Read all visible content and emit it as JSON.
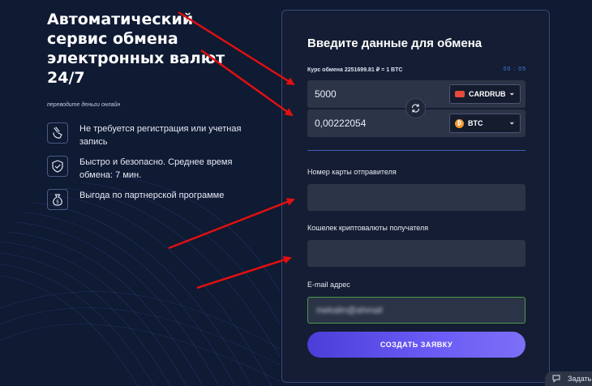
{
  "hero": {
    "title": "Автоматический сервис обмена электронных валют 24/7",
    "subtitle": "переводите деньги онлайн"
  },
  "features": [
    {
      "icon": "hand-swipe-icon",
      "text": "Не требуется регистрация или учетная запись"
    },
    {
      "icon": "shield-check-icon",
      "text": "Быстро и безопасно. Среднее время обмена: 7 мин."
    },
    {
      "icon": "money-bag-icon",
      "text": "Выгода по партнерской программе"
    }
  ],
  "form": {
    "title": "Введите данные для обмена",
    "rate": "Курс обмена 2251699.81 ₽ = 1 BTC",
    "timer": "00 : 05",
    "give": {
      "amount": "5000",
      "currency": "CARDRUB",
      "icon": "card-icon"
    },
    "get": {
      "amount": "0,00222054",
      "currency": "BTC",
      "icon": "bitcoin-icon"
    },
    "sender_card_label": "Номер карты отправителя",
    "sender_card_value": "",
    "wallet_label": "Кошелек криптовалюты получателя",
    "wallet_value": "",
    "email_label": "E-mail адрес",
    "email_value": "mekalin@ahmail",
    "submit_label": "СОЗДАТЬ ЗАЯВКУ"
  },
  "chat": {
    "label": "Задать"
  },
  "colors": {
    "background": "#0f1a33",
    "card": "#141d33",
    "field": "#2c3447",
    "accent": "#6a5af5",
    "timer": "#3f7fe0",
    "email_border": "#4a9a4a",
    "annotation_arrows": "#e01010"
  }
}
